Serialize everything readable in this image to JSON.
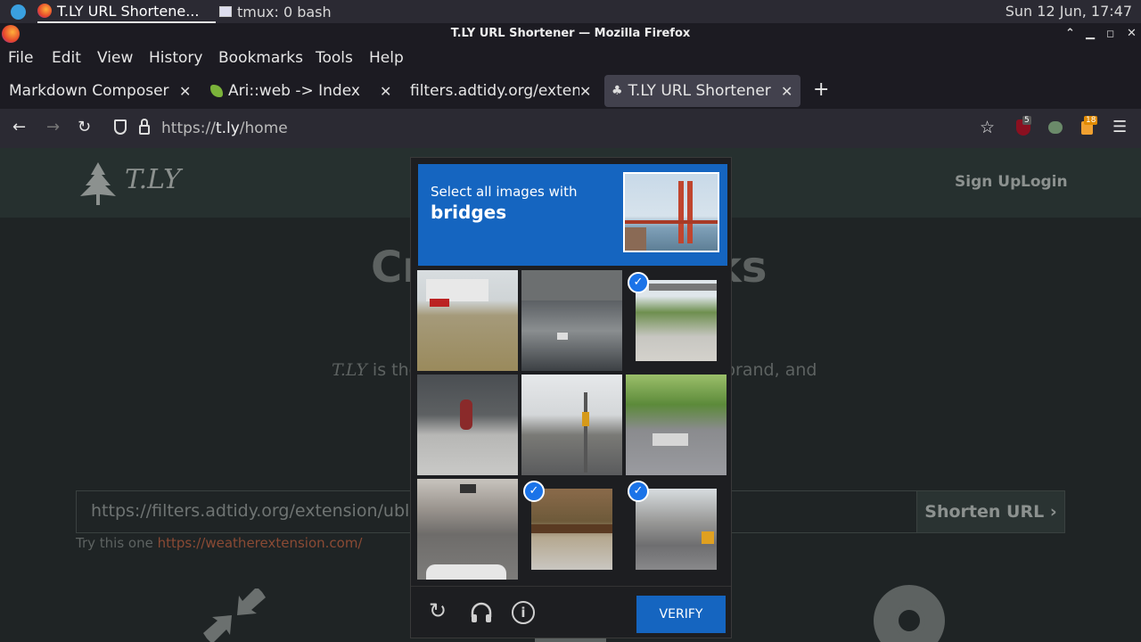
{
  "system_bar": {
    "tasks": [
      {
        "label": "T.LY URL Shortene..."
      },
      {
        "label": "tmux: 0 bash"
      }
    ],
    "clock": "Sun 12 Jun, 17:47"
  },
  "window": {
    "title": "T.LY URL Shortener — Mozilla Firefox"
  },
  "menu": [
    "File",
    "Edit",
    "View",
    "History",
    "Bookmarks",
    "Tools",
    "Help"
  ],
  "tabs": [
    {
      "label": "Markdown Composer"
    },
    {
      "label": "Ari::web -> Index"
    },
    {
      "label": "filters.adtidy.org/extens"
    },
    {
      "label": "T.LY URL Shortener"
    }
  ],
  "navbar": {
    "url_prefix": "https://",
    "url_host": "t.ly",
    "url_path": "/home",
    "ublock_count": "5",
    "ext_badge": "18"
  },
  "page": {
    "logo": "T.LY",
    "nav": [
      "Sign Up",
      "Login"
    ],
    "hero_left": "Cr",
    "hero_right": "ks",
    "subtitle_brand": "T.LY",
    "subtitle_left": " is the",
    "subtitle_right": "brand, and",
    "input_value": "https://filters.adtidy.org/extension/ublo",
    "shorten_label": "Shorten URL",
    "try_text": "Try this one ",
    "try_link": "https://weatherextension.com/"
  },
  "captcha": {
    "line1": "Select all images with",
    "line2": "bridges",
    "tiles_selected": [
      false,
      false,
      true,
      false,
      false,
      false,
      false,
      true,
      true
    ],
    "verify_label": "VERIFY"
  },
  "colors": {
    "accent": "#1565c0",
    "check": "#1a73e8"
  }
}
